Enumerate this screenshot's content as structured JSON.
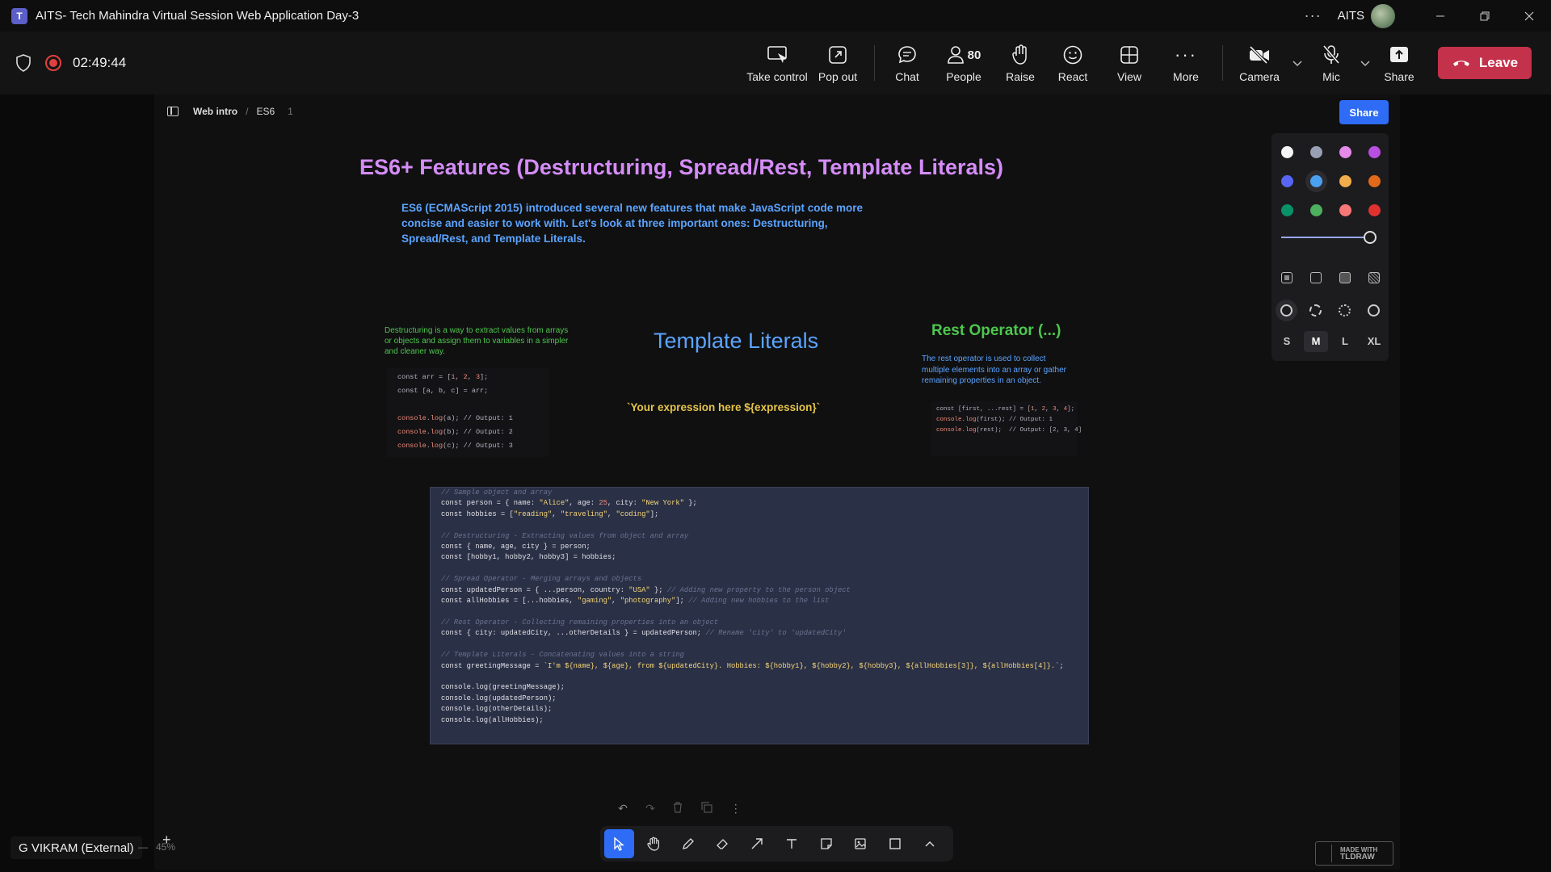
{
  "window": {
    "title": "AITS- Tech Mahindra Virtual Session Web Application Day-3",
    "org": "AITS",
    "app_icon": "T"
  },
  "meeting": {
    "timer": "02:49:44",
    "controls": {
      "take_control": "Take control",
      "pop_out": "Pop out",
      "chat": "Chat",
      "people": "People",
      "people_count": "80",
      "raise": "Raise",
      "react": "React",
      "view": "View",
      "more": "More",
      "camera": "Camera",
      "mic": "Mic",
      "share": "Share",
      "leave": "Leave"
    },
    "participant_name": "G VIKRAM (External)"
  },
  "tldraw": {
    "breadcrumb": {
      "folder": "Web intro",
      "page": "ES6",
      "page_count": "1"
    },
    "share_label": "Share",
    "zoom": "45%",
    "made_with_line1": "MADE WITH",
    "made_with_line2": "TLDRAW",
    "palette": [
      "#f5f5f5",
      "#9aa0b4",
      "#e48ae8",
      "#b84fe0",
      "#5865f2",
      "#4ba1f1",
      "#f1ac4b",
      "#e16919",
      "#099268",
      "#4cb05e",
      "#f87777",
      "#e03131"
    ],
    "selected_color_index": 5,
    "sizes": [
      "S",
      "M",
      "L",
      "XL"
    ],
    "selected_size": "M"
  },
  "canvas": {
    "main_title": "ES6+ Features (Destructuring, Spread/Rest, Template Literals)",
    "intro": "ES6 (ECMAScript 2015) introduced several new features that make JavaScript code more concise and easier to work with. Let's look at three important ones: Destructuring, Spread/Rest, and Template Literals.",
    "destructuring_text": "Destructuring is a way to extract values from arrays or objects and assign them to variables in a simpler and cleaner way.",
    "template_title": "Template Literals",
    "template_expr": "`Your expression here ${expression}`",
    "rest_title": "Rest Operator (...)",
    "rest_text": "The rest operator is used to collect multiple elements into an array or gather remaining properties in an object."
  }
}
